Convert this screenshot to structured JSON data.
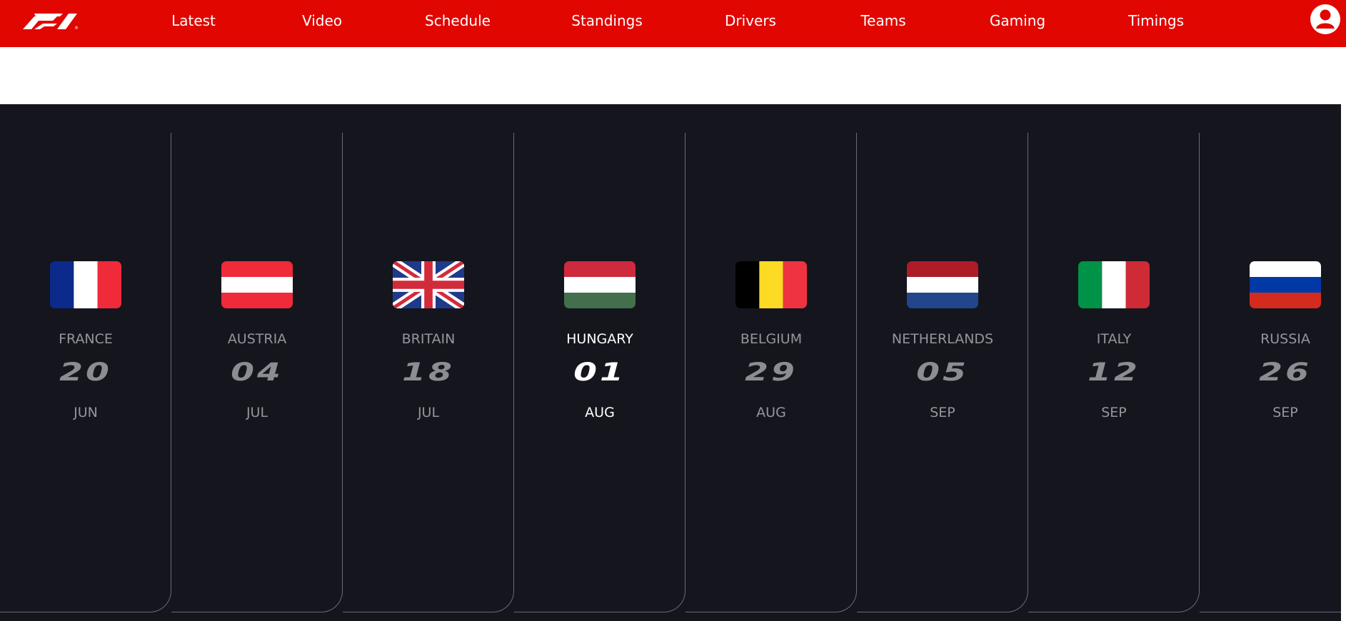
{
  "nav": {
    "logo": "F1",
    "items": [
      "Latest",
      "Video",
      "Schedule",
      "Standings",
      "Drivers",
      "Teams",
      "Gaming",
      "Timings"
    ]
  },
  "colors": {
    "brand_red": "#e10600",
    "schedule_bg": "#15151e",
    "muted_text": "#95959c",
    "active_text": "#ffffff"
  },
  "races": [
    {
      "country": "FRANCE",
      "day": "20",
      "month": "JUN",
      "flag": "france-flag-icon",
      "active": false
    },
    {
      "country": "AUSTRIA",
      "day": "04",
      "month": "JUL",
      "flag": "austria-flag-icon",
      "active": false
    },
    {
      "country": "BRITAIN",
      "day": "18",
      "month": "JUL",
      "flag": "britain-flag-icon",
      "active": false
    },
    {
      "country": "HUNGARY",
      "day": "01",
      "month": "AUG",
      "flag": "hungary-flag-icon",
      "active": true
    },
    {
      "country": "BELGIUM",
      "day": "29",
      "month": "AUG",
      "flag": "belgium-flag-icon",
      "active": false
    },
    {
      "country": "NETHERLANDS",
      "day": "05",
      "month": "SEP",
      "flag": "netherlands-flag-icon",
      "active": false
    },
    {
      "country": "ITALY",
      "day": "12",
      "month": "SEP",
      "flag": "italy-flag-icon",
      "active": false
    },
    {
      "country": "RUSSIA",
      "day": "26",
      "month": "SEP",
      "flag": "russia-flag-icon",
      "active": false
    }
  ]
}
